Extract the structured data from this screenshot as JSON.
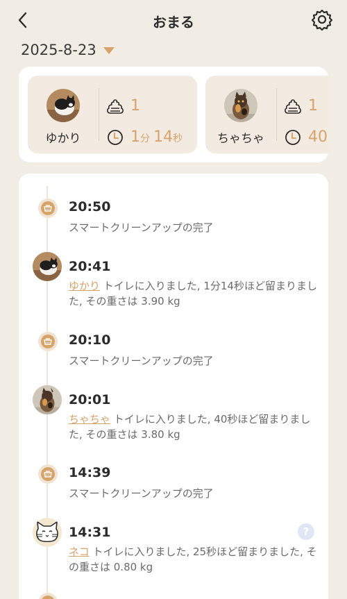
{
  "header": {
    "title": "おまる",
    "back_icon": "chevron-left-icon",
    "settings_icon": "gear-icon"
  },
  "date": {
    "value": "2025-8-23",
    "dropdown_icon": "caret-down-icon"
  },
  "summary": [
    {
      "name": "ゆかり",
      "count": "1",
      "duration_min": "1",
      "min_unit": "分",
      "duration_sec": "14",
      "sec_unit": "秒"
    },
    {
      "name": "ちゃちゃ",
      "count": "1",
      "duration_sec": "40"
    }
  ],
  "events": [
    {
      "type": "cleanup",
      "time": "20:50",
      "desc": "スマートクリーンアップの完了"
    },
    {
      "type": "visit",
      "time": "20:41",
      "cat": "ゆかり",
      "desc": " トイレに入りました, 1分14秒ほど留まりました, その重さは 3.90 kg"
    },
    {
      "type": "cleanup",
      "time": "20:10",
      "desc": "スマートクリーンアップの完了"
    },
    {
      "type": "visit",
      "time": "20:01",
      "cat": "ちゃちゃ",
      "desc": " トイレに入りました, 40秒ほど留まりました, その重さは 3.80 kg"
    },
    {
      "type": "cleanup",
      "time": "14:39",
      "desc": "スマートクリーンアップの完了"
    },
    {
      "type": "visit",
      "time": "14:31",
      "cat": "ネコ",
      "desc": " トイレに入りました, 25秒ほど留まりました, その重さは 0.80 kg",
      "help": "?"
    }
  ],
  "colors": {
    "accent": "#d6a36a",
    "background": "#f1ede5",
    "card": "#f3ebe1"
  }
}
